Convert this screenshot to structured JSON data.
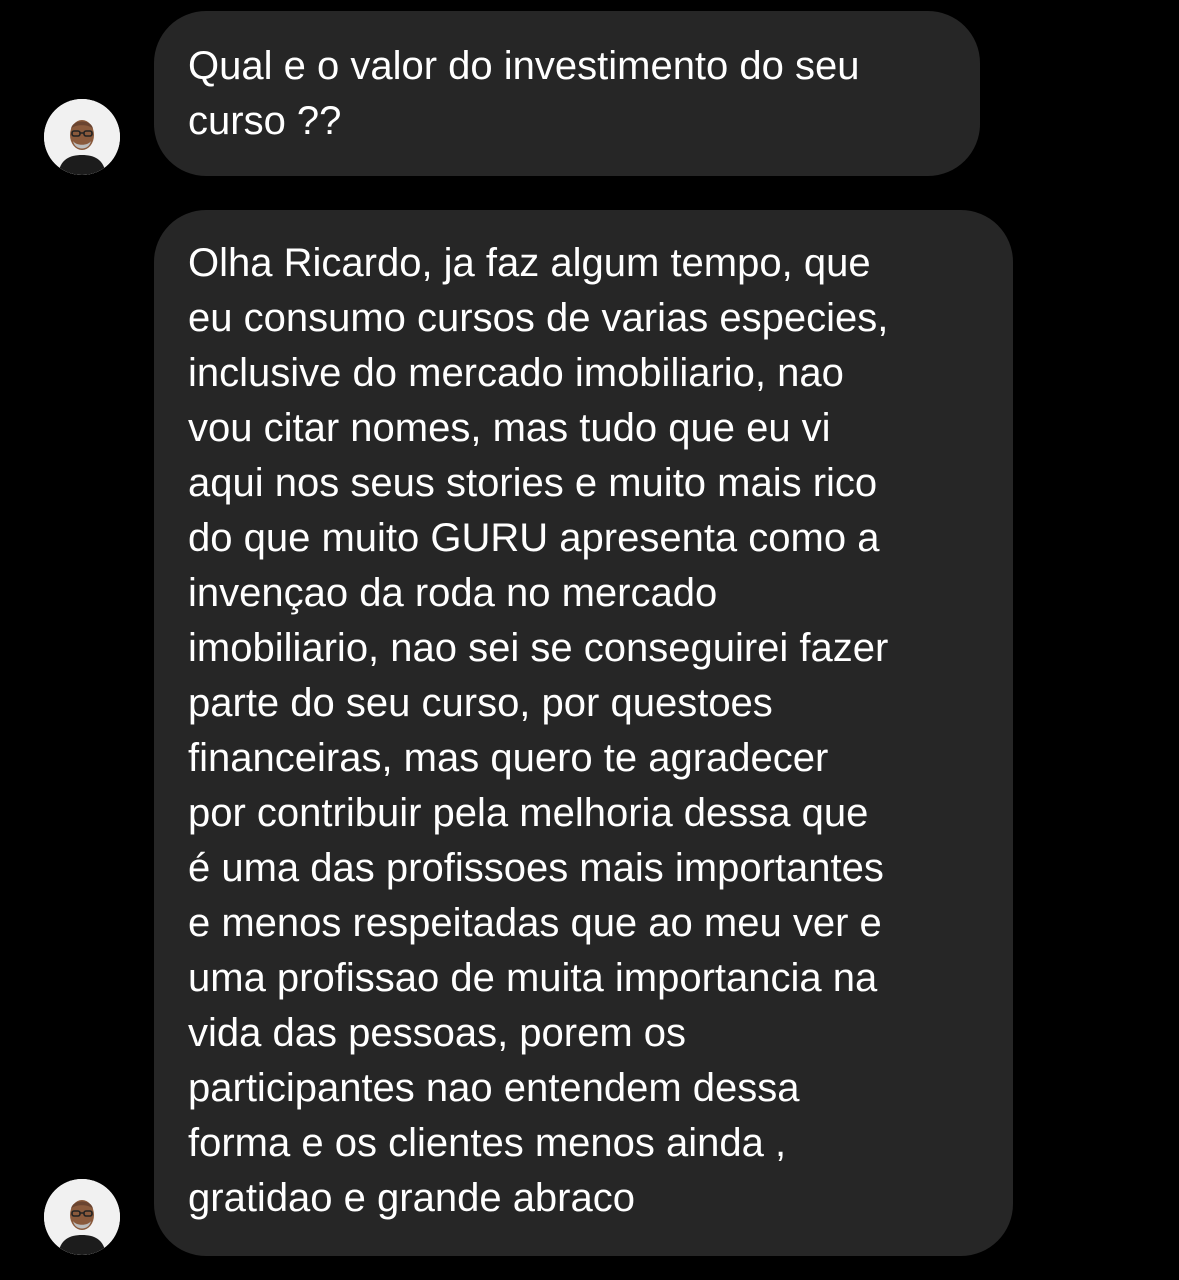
{
  "conversation": {
    "messages": [
      {
        "sender": "contact",
        "text": "Qual e o valor do investimento do seu\ncurso ??"
      },
      {
        "sender": "contact",
        "text": "Olha Ricardo, ja faz algum tempo, que\neu consumo cursos de varias especies,\ninclusive do mercado imobiliario, nao\nvou citar nomes, mas tudo que eu vi\naqui nos seus stories e muito mais rico\ndo que muito GURU apresenta como a\ninvençao da roda no mercado\nimobiliario, nao sei se conseguirei fazer\nparte do seu curso, por questoes\nfinanceiras, mas quero te agradecer\npor contribuir pela melhoria dessa que\né uma das profissoes mais importantes\ne menos respeitadas que ao meu ver e\numa profissao de muita importancia na\nvida das pessoas, porem os\nparticipantes nao entendem dessa\nforma e os clientes menos ainda ,\ngratidao e grande abraco"
      }
    ]
  },
  "colors": {
    "background": "#000000",
    "bubble": "#262626",
    "text": "#ffffff"
  },
  "icons": {
    "avatar": "contact-avatar-photo"
  }
}
